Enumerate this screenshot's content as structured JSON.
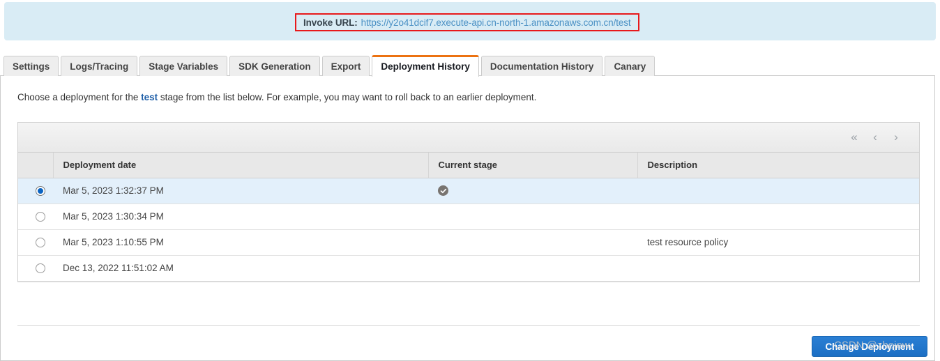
{
  "banner": {
    "label": "Invoke URL:",
    "url": "https://y2o41dcif7.execute-api.cn-north-1.amazonaws.com.cn/test",
    "border_color": "#e8191b",
    "background": "#d9ecf5"
  },
  "tabs": [
    {
      "label": "Settings",
      "active": false
    },
    {
      "label": "Logs/Tracing",
      "active": false
    },
    {
      "label": "Stage Variables",
      "active": false
    },
    {
      "label": "SDK Generation",
      "active": false
    },
    {
      "label": "Export",
      "active": false
    },
    {
      "label": "Deployment History",
      "active": true
    },
    {
      "label": "Documentation History",
      "active": false
    },
    {
      "label": "Canary",
      "active": false
    }
  ],
  "main": {
    "intro_prefix": "Choose a deployment for the ",
    "intro_stage": "test",
    "intro_suffix": " stage from the list below. For example, you may want to roll back to an earlier deployment.",
    "pagination": {
      "first_label": "«",
      "prev_label": "‹",
      "next_label": "›"
    },
    "columns": [
      "",
      "Deployment date",
      "Current stage",
      "Description"
    ],
    "rows": [
      {
        "selected": true,
        "date": "Mar 5, 2023 1:32:37 PM",
        "current_stage": true,
        "description": ""
      },
      {
        "selected": false,
        "date": "Mar 5, 2023 1:30:34 PM",
        "current_stage": false,
        "description": ""
      },
      {
        "selected": false,
        "date": "Mar 5, 2023 1:10:55 PM",
        "current_stage": false,
        "description": "test resource policy"
      },
      {
        "selected": false,
        "date": "Dec 13, 2022 11:51:02 AM",
        "current_stage": false,
        "description": ""
      }
    ],
    "change_deployment_label": "Change Deployment",
    "accent_color": "#ec7211",
    "primary_button_color": "#1c6fc4"
  },
  "watermark": "CSDN @zhojew"
}
